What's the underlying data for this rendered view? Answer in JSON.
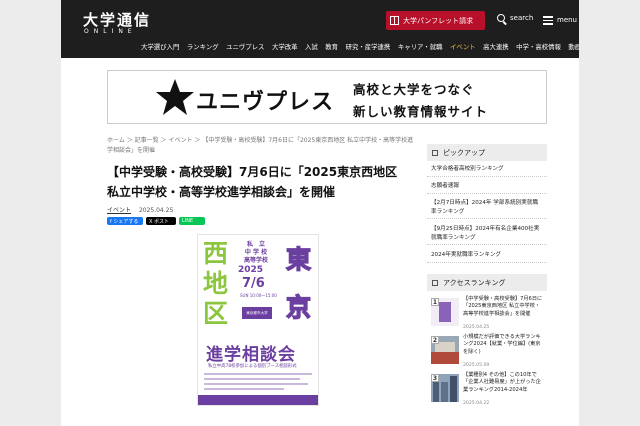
{
  "header": {
    "logo_main": "大学通信",
    "logo_sub": "ONLINE",
    "pamphlet_label": "大学パンフレット請求",
    "search_label": "search",
    "menu_label": "menu"
  },
  "nav": {
    "items": [
      {
        "label": "大学選び入門"
      },
      {
        "label": "ランキング"
      },
      {
        "label": "ユニヴプレス"
      },
      {
        "label": "大学改革"
      },
      {
        "label": "入試"
      },
      {
        "label": "教育"
      },
      {
        "label": "研究・産学連携"
      },
      {
        "label": "キャリア・就職"
      },
      {
        "label": "イベント"
      },
      {
        "label": "高大連携"
      },
      {
        "label": "中学・高校情報"
      },
      {
        "label": "動画"
      }
    ],
    "active_index": 8,
    "active_color": "#f0c040"
  },
  "banner": {
    "brand": "ユニヴプレス",
    "tagline_1": "高校と大学をつなぐ",
    "tagline_2": "新しい教育情報サイト"
  },
  "breadcrumb": {
    "home": "ホーム",
    "list": "記事一覧",
    "category": "イベント",
    "current": "【中学受験・高校受験】7月6日に「2025東京西地区 私立中学校・高等学校進学相談会」を開催"
  },
  "article": {
    "title": "【中学受験・高校受験】7月6日に「2025東京西地区 私立中学校・高等学校進学相談会」を開催",
    "category": "イベント",
    "date": "2025.04.25",
    "share_fb": "f シェアする",
    "share_x": "X ポスト",
    "share_line": "LINE"
  },
  "poster": {
    "left_chars": [
      "西",
      "地",
      "区"
    ],
    "right_chars": [
      "東",
      "京"
    ],
    "school_lines": [
      "私　立",
      "中 学 校",
      "高等学校"
    ],
    "year": "2025",
    "date": "7/6",
    "day": "SUN",
    "time": "10:00〜15:00",
    "venue": "東京都市大学",
    "headline": "進学相談会",
    "subtext": "私立中高78校参加による個別ブース相談形式"
  },
  "sidebar": {
    "pickup_title": "ピックアップ",
    "pickup_items": [
      "大学合格者高校別ランキング",
      "志願者速報",
      "【2月7日時点】2024年 学部系統別実就職率ランキング",
      "【9月25日時点】2024年有名企業400社実就職率ランキング",
      "2024年実就職率ランキング"
    ],
    "ranking_title": "アクセスランキング",
    "ranking_items": [
      {
        "num": "1",
        "text": "【中学受験・高校受験】7月6日に「2025東京西地区 私立中学校・高等学校進学相談会」を開催",
        "date": "2025.04.25"
      },
      {
        "num": "2",
        "text": "小規模だが評価できる大学ランキング2024【就業・学位編】(東京を除く)",
        "date": "2025.05.09"
      },
      {
        "num": "3",
        "text": "【業種別4 その他】この10年で「企業人社難易度」が上がった企業ランキング2014-2024年",
        "date": "2025.04.22"
      }
    ]
  }
}
